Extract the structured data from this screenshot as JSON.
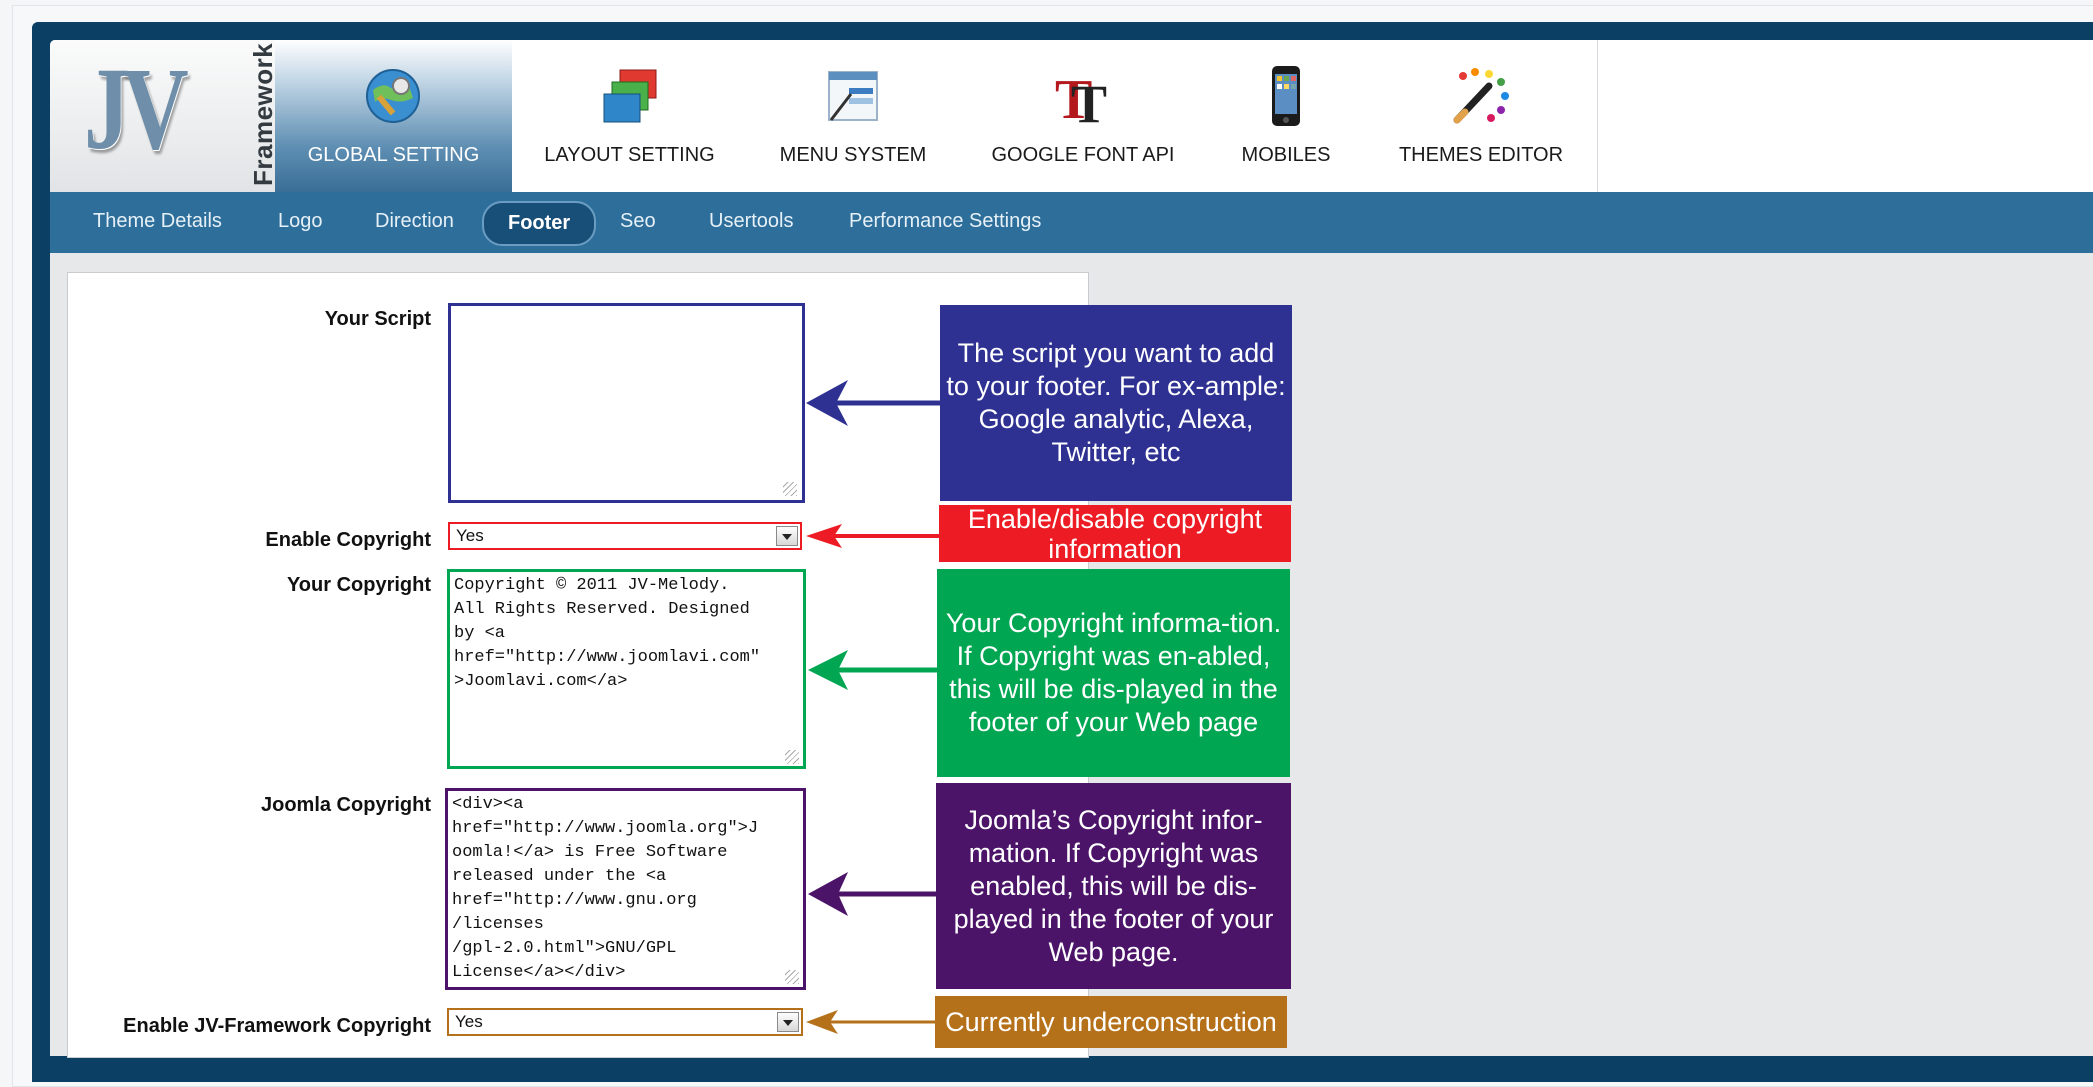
{
  "logo": {
    "letters": "JV",
    "word": "Framework"
  },
  "tabs": [
    {
      "label": "GLOBAL SETTING",
      "icon": "global-setting-icon",
      "active": true
    },
    {
      "label": "LAYOUT SETTING",
      "icon": "layout-setting-icon"
    },
    {
      "label": "MENU SYSTEM",
      "icon": "menu-system-icon"
    },
    {
      "label": "GOOGLE FONT API",
      "icon": "google-font-icon"
    },
    {
      "label": "MOBILES",
      "icon": "mobile-phone-icon"
    },
    {
      "label": "THEMES EDITOR",
      "icon": "themes-editor-icon"
    }
  ],
  "subnav": [
    "Theme Details",
    "Logo",
    "Direction",
    "Footer",
    "Seo",
    "Usertools",
    "Performance Settings"
  ],
  "subnav_active": "Footer",
  "form": {
    "your_script": {
      "label": "Your Script",
      "value": ""
    },
    "enable_copyright": {
      "label": "Enable Copyright",
      "value": "Yes"
    },
    "your_copyright": {
      "label": "Your Copyright",
      "value": "Copyright © 2011 JV-Melody.\nAll Rights Reserved. Designed\nby <a\nhref=\"http://www.joomlavi.com\"\n>Joomlavi.com</a>"
    },
    "joomla_copyright": {
      "label": "Joomla Copyright",
      "value": "<div><a\nhref=\"http://www.joomla.org\">J\noomla!</a> is Free Software\nreleased under the <a\nhref=\"http://www.gnu.org\n/licenses\n/gpl-2.0.html\">GNU/GPL\nLicense</a></div>"
    },
    "enable_jv_copyright": {
      "label": "Enable JV-Framework Copyright",
      "value": "Yes"
    }
  },
  "callouts": {
    "script": "The script you want to add to your footer. For ex-ample: Google analytic, Alexa, Twitter, etc",
    "enable_copyright": "Enable/disable copyright information",
    "your_copyright": "Your Copyright informa-tion. If Copyright was en-abled, this will be dis-played in the footer of your Web page",
    "joomla_copyright": "Joomla’s Copyright infor-mation. If Copyright was enabled, this will be dis-played in the footer of your Web page.",
    "jv_copyright": "Currently underconstruction"
  },
  "colors": {
    "script": "#2e3192",
    "enable_copyright": "#ed1c24",
    "your_copyright": "#00a651",
    "joomla_copyright": "#4b1468",
    "jv_copyright": "#b5701a"
  }
}
